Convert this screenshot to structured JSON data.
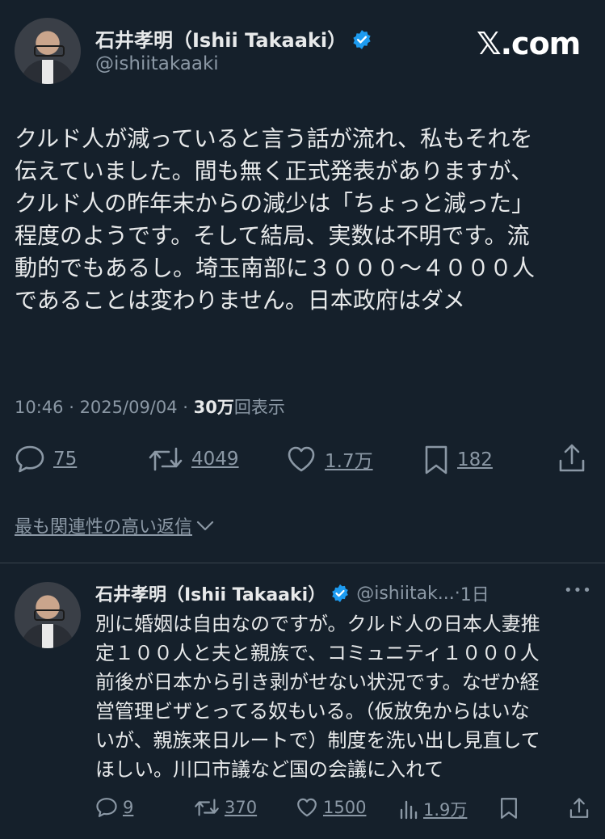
{
  "brand": {
    "logo_text": "𝕏.com"
  },
  "main_tweet": {
    "author_name": "石井孝明（Ishii Takaaki）",
    "author_handle": "@ishiitakaaki",
    "text_lines": [
      "クルド人が減っていると言う話が流れ、私もそれを",
      "伝えていました。間も無く正式発表がありますが、",
      "クルド人の昨年末からの減少は「ちょっと減った」",
      "程度のようです。そして結局、実数は不明です。流",
      "動的でもあるし。埼玉南部に３０００〜４０００人",
      "であることは変わりません。日本政府はダメ"
    ],
    "time": "10:46",
    "date": "2025/09/04",
    "views_count": "30万",
    "views_label": "回表示",
    "replies": "75",
    "retweets": "4049",
    "likes": "1.7万",
    "bookmarks": "182"
  },
  "related_replies_label": "最も関連性の高い返信",
  "reply": {
    "author_name": "石井孝明（Ishii Takaaki）",
    "author_handle": "@ishiitak...",
    "age": "1日",
    "more": "•••",
    "text_lines": [
      "別に婚姻は自由なのですが。クルド人の日本人妻推",
      "定１００人と夫と親族で、コミュニティ１０００人",
      "前後が日本から引き剥がせない状況です。なぜか経",
      "営管理ビザとってる奴もいる。（仮放免からはいな",
      "いが、親族来日ルートで）制度を洗い出し見直して",
      "ほしい。川口市議など国の会議に入れて"
    ],
    "replies": "9",
    "retweets": "370",
    "likes": "1500",
    "views": "1.9万"
  },
  "colors": {
    "background": "#15202b",
    "text": "#e7e9ea",
    "muted": "#8b98a5",
    "verified": "#1d9bf0",
    "divider": "#38444d"
  }
}
